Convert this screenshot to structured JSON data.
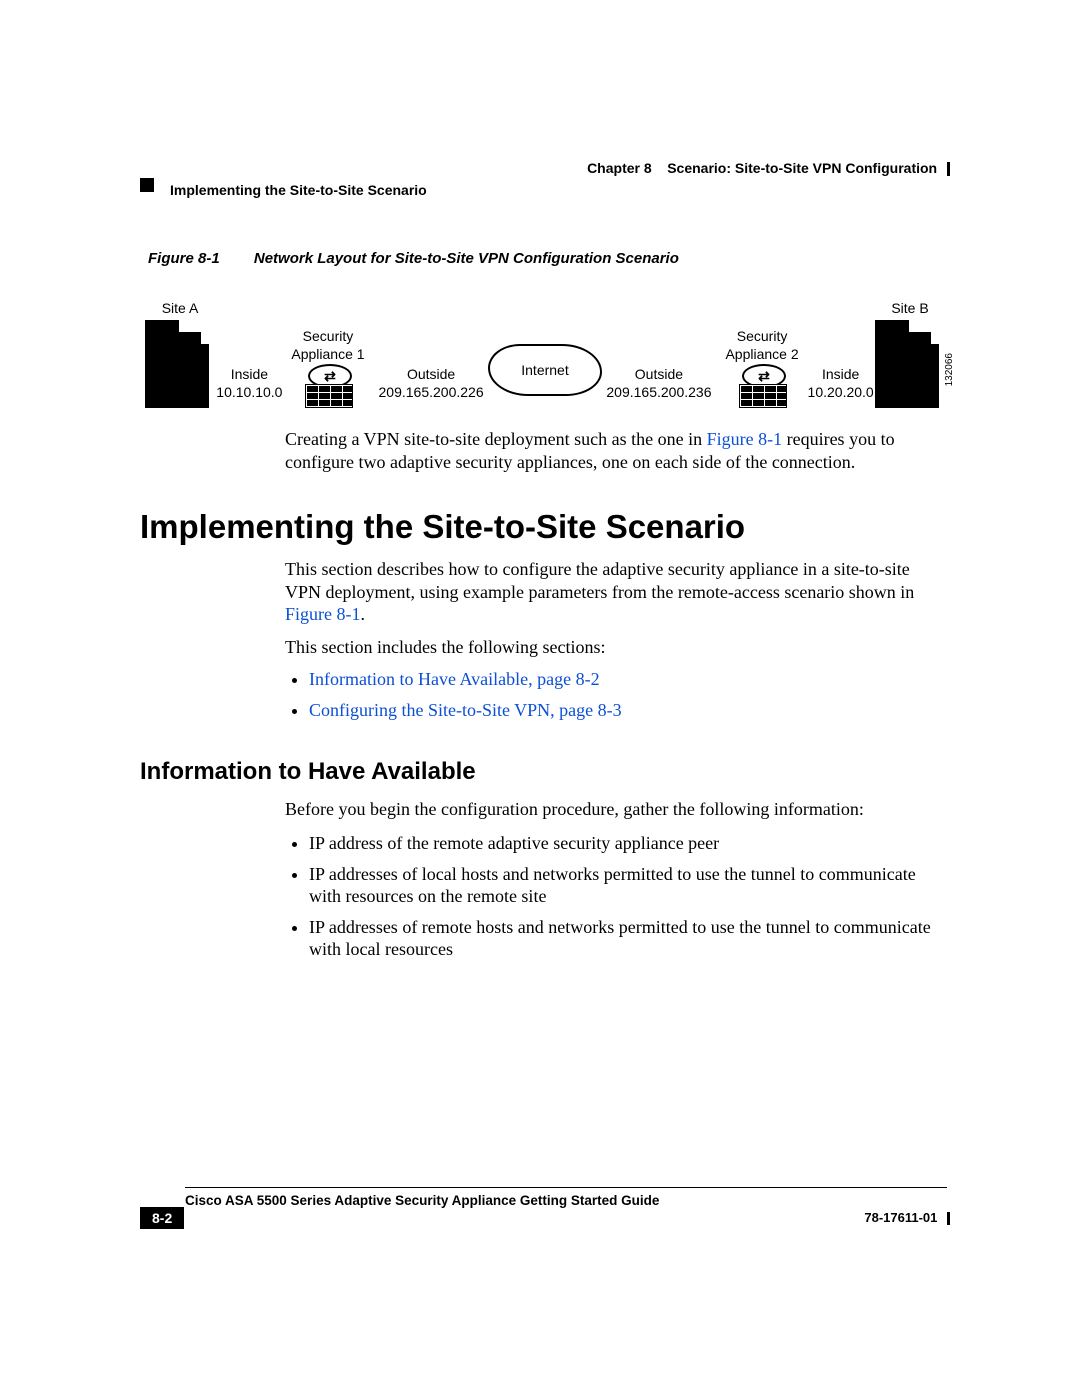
{
  "header": {
    "chapter_label": "Chapter 8",
    "chapter_title": "Scenario: Site-to-Site VPN Configuration",
    "section_running": "Implementing the Site-to-Site Scenario"
  },
  "figure": {
    "label": "Figure 8-1",
    "title": "Network Layout for Site-to-Site VPN Configuration Scenario",
    "image_id": "132066",
    "site_a": "Site A",
    "site_b": "Site B",
    "appliance1_top": "Security",
    "appliance1_bottom": "Appliance 1",
    "appliance2_top": "Security",
    "appliance2_bottom": "Appliance 2",
    "inside_a_label": "Inside",
    "inside_a_ip": "10.10.10.0",
    "outside_a_label": "Outside",
    "outside_a_ip": "209.165.200.226",
    "internet": "Internet",
    "outside_b_label": "Outside",
    "outside_b_ip": "209.165.200.236",
    "inside_b_label": "Inside",
    "inside_b_ip": "10.20.20.0"
  },
  "body": {
    "fig_para_pre": "Creating a VPN site-to-site deployment such as the one in ",
    "fig_para_link": "Figure 8-1",
    "fig_para_post": " requires you to configure two adaptive security appliances, one on each side of the connection.",
    "h1": "Implementing the Site-to-Site Scenario",
    "h1_para_pre": "This section describes how to configure the adaptive security appliance in a site-to-site VPN deployment, using example parameters from the remote-access scenario shown in ",
    "h1_para_link": "Figure 8-1",
    "h1_para_post": ".",
    "includes_intro": "This section includes the following sections:",
    "links": {
      "l1": "Information to Have Available, page 8-2",
      "l2": "Configuring the Site-to-Site VPN, page 8-3"
    },
    "h2": "Information to Have Available",
    "h2_intro": "Before you begin the configuration procedure, gather the following information:",
    "bullets": {
      "b1": "IP address of the remote adaptive security appliance peer",
      "b2": "IP addresses of local hosts and networks permitted to use the tunnel to communicate with resources on the remote site",
      "b3": "IP addresses of remote hosts and networks permitted to use the tunnel to communicate with local resources"
    }
  },
  "footer": {
    "guide_title": "Cisco ASA 5500 Series Adaptive Security Appliance Getting Started Guide",
    "page_num": "8-2",
    "doc_num": "78-17611-01"
  }
}
